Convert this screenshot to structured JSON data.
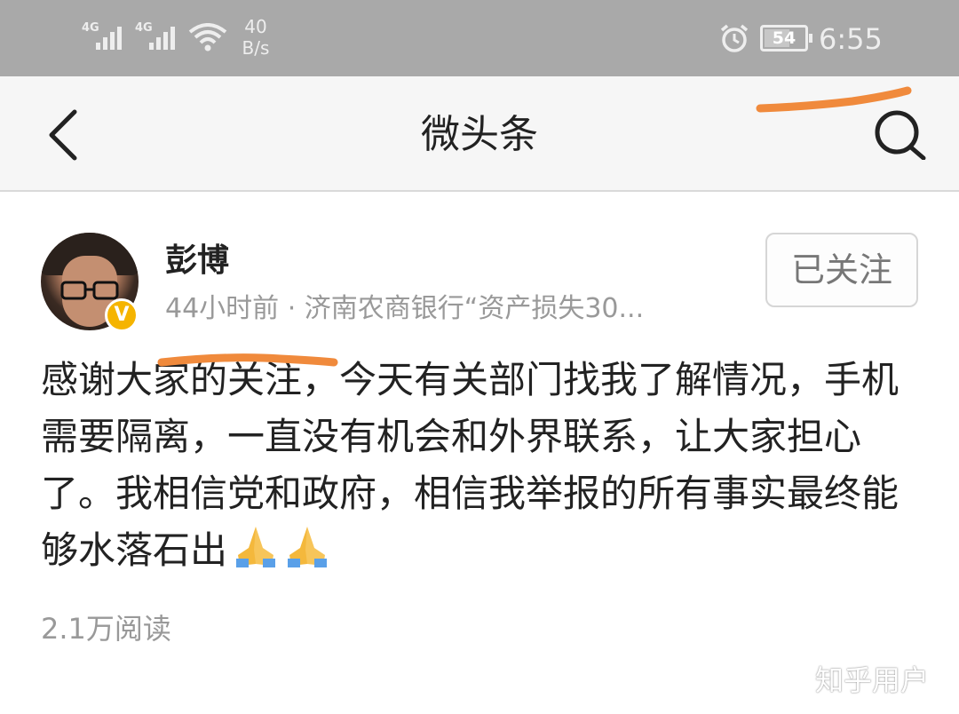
{
  "status_bar": {
    "signal1_label": "4G",
    "signal2_label": "4G",
    "net_speed_value": "40",
    "net_speed_unit": "B/s",
    "battery": "54",
    "time": "6:55"
  },
  "nav": {
    "title": "微头条",
    "back_icon": "chevron-left-icon",
    "search_icon": "search-icon"
  },
  "post": {
    "author": "彭博",
    "verified_badge": "V",
    "meta": "44小时前 · 济南农商银行“资产损失30...",
    "follow_label": "已关注",
    "body": "感谢大家的关注，今天有关部门找我了解情况，手机需要隔离，一直没有机会和外界联系，让大家担心了。我相信党和政府，相信我举报的所有事实最终能够水落石出",
    "emoji": "🙏🙏",
    "read_count": "2.1万阅读"
  },
  "watermark": "知乎用户",
  "colors": {
    "status_bar_bg": "#a9a9a9",
    "nav_bg": "#f6f6f6",
    "scribble": "#f08a3c",
    "badge": "#f5b400"
  }
}
